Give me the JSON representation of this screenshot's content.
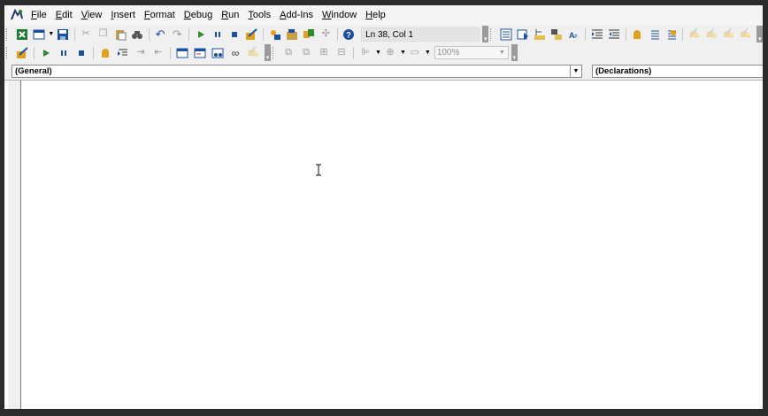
{
  "menu": {
    "items": [
      "File",
      "Edit",
      "View",
      "Insert",
      "Format",
      "Debug",
      "Run",
      "Tools",
      "Add-Ins",
      "Window",
      "Help"
    ]
  },
  "toolbar": {
    "position_text": "Ln 38, Col 1",
    "zoom_value": "100%"
  },
  "code_window": {
    "object_combo": "(General)",
    "procedure_combo": "(Declarations)"
  },
  "colors": {
    "accent_green": "#2e8b2e",
    "accent_blue": "#1c4fa0",
    "accent_orange": "#e0a020"
  }
}
